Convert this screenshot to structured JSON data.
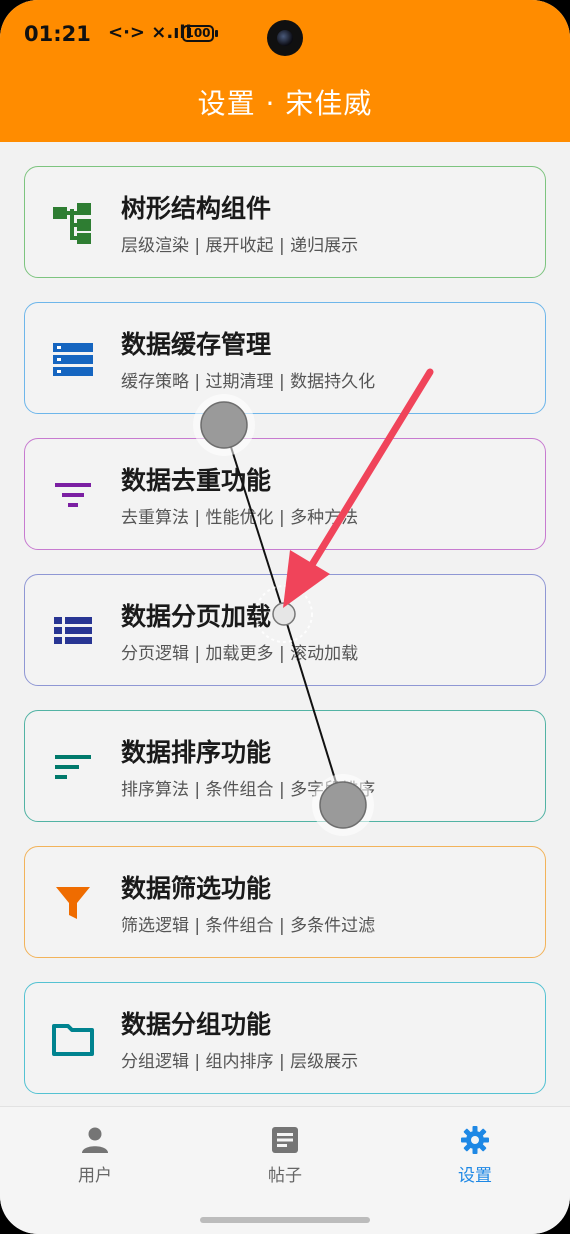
{
  "status": {
    "time": "01:21",
    "signal": "<·> ×.ıll",
    "battery": "100"
  },
  "header": {
    "title": "设置 · 宋佳威"
  },
  "cards": [
    {
      "title": "树形结构组件",
      "desc": "层级渲染 | 展开收起 | 递归展示",
      "border": "#7dc47f",
      "icon_color": "#2e7d32",
      "icon": "tree-icon"
    },
    {
      "title": "数据缓存管理",
      "desc": "缓存策略 | 过期清理 | 数据持久化",
      "border": "#6eb6ea",
      "icon_color": "#1565c0",
      "icon": "storage-icon"
    },
    {
      "title": "数据去重功能",
      "desc": "去重算法 | 性能优化 | 多种方法",
      "border": "#c77bd0",
      "icon_color": "#7b1fa2",
      "icon": "filter-lines-icon"
    },
    {
      "title": "数据分页加载",
      "desc": "分页逻辑 | 加载更多 | 滚动加载",
      "border": "#8f97d4",
      "icon_color": "#283593",
      "icon": "list-icon"
    },
    {
      "title": "数据排序功能",
      "desc": "排序算法 | 条件组合 | 多字段排序",
      "border": "#52b3a4",
      "icon_color": "#00796b",
      "icon": "sort-icon"
    },
    {
      "title": "数据筛选功能",
      "desc": "筛选逻辑 | 条件组合 | 多条件过滤",
      "border": "#f2b35a",
      "icon_color": "#ef6c00",
      "icon": "funnel-icon"
    },
    {
      "title": "数据分组功能",
      "desc": "分组逻辑 | 组内排序 | 层级展示",
      "border": "#54c2d2",
      "icon_color": "#00838f",
      "icon": "folder-icon"
    }
  ],
  "tabs": [
    {
      "label": "用户",
      "icon": "person-icon",
      "active": false
    },
    {
      "label": "帖子",
      "icon": "article-icon",
      "active": false
    },
    {
      "label": "设置",
      "icon": "gear-icon",
      "active": true
    }
  ],
  "colors": {
    "appbar": "#ff8c00",
    "active_tab": "#1e88e5",
    "arrow": "#f0445a"
  }
}
